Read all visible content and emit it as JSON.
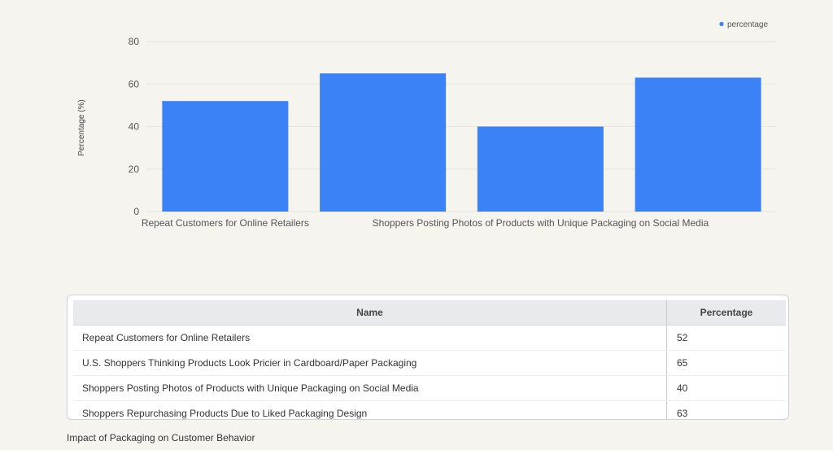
{
  "chart_data": {
    "type": "bar",
    "categories": [
      "Repeat Customers for Online Retailers",
      "U.S. Shoppers Thinking Products Look Pricier in Cardboard/Paper Packaging",
      "Shoppers Posting Photos of Products with Unique Packaging on Social Media",
      "Shoppers Repurchasing Products Due to Liked Packaging Design"
    ],
    "visible_category_labels": [
      "Repeat Customers for Online Retailers",
      "",
      "Shoppers Posting Photos of Products with Unique Packaging on Social Media",
      ""
    ],
    "series": [
      {
        "name": "percentage",
        "values": [
          52,
          65,
          40,
          63
        ],
        "color": "#3b82f6"
      }
    ],
    "ylabel": "Percentage (%)",
    "xlabel": "",
    "ylim": [
      0,
      80
    ],
    "yticks": [
      0,
      20,
      40,
      60,
      80
    ],
    "grid": true,
    "legend_position": "top-right"
  },
  "table": {
    "headers": {
      "name": "Name",
      "value": "Percentage"
    },
    "rows": [
      {
        "name": "Repeat Customers for Online Retailers",
        "value": "52"
      },
      {
        "name": "U.S. Shoppers Thinking Products Look Pricier in Cardboard/Paper Packaging",
        "value": "65"
      },
      {
        "name": "Shoppers Posting Photos of Products with Unique Packaging on Social Media",
        "value": "40"
      },
      {
        "name": "Shoppers Repurchasing Products Due to Liked Packaging Design",
        "value": "63"
      }
    ]
  },
  "caption": "Impact of Packaging on Customer Behavior",
  "colors": {
    "background": "#f5f4ef",
    "bar": "#3b82f6"
  }
}
